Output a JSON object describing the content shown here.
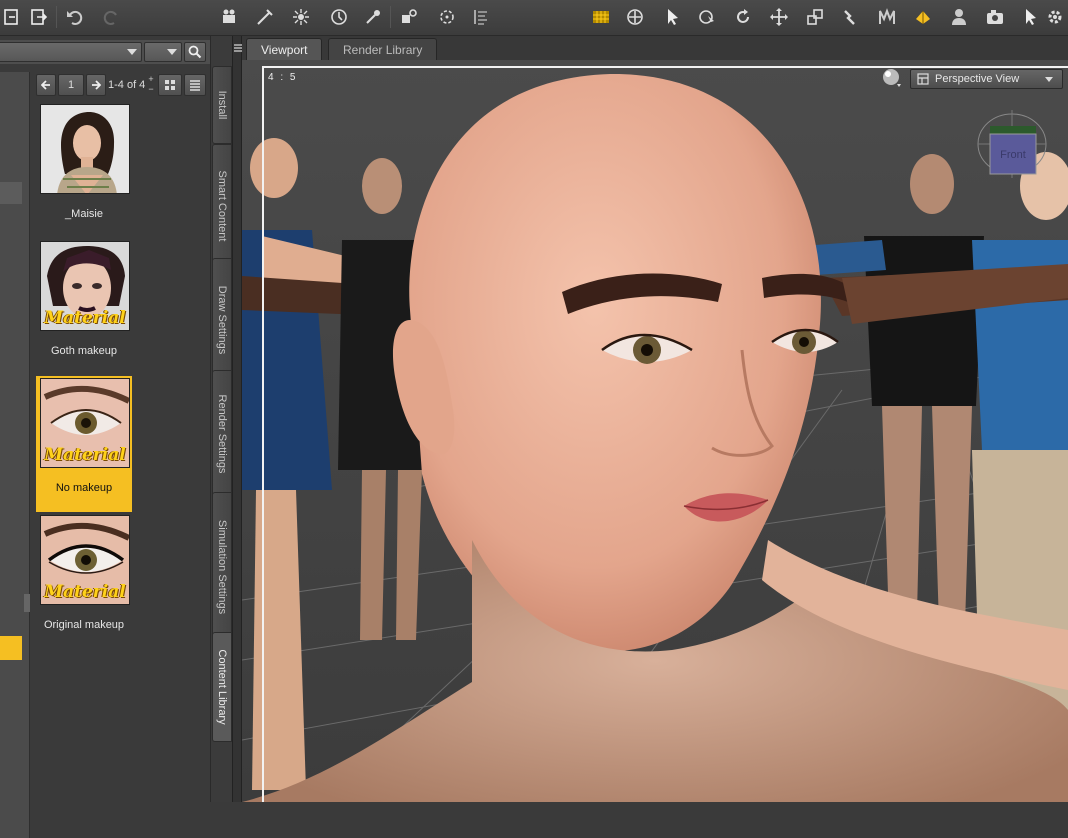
{
  "toolbar": {
    "icons": [
      "new-file-icon",
      "export-icon",
      "undo-icon",
      "redo-icon",
      "figure-camera-icon",
      "spotlight-icon",
      "distant-light-icon",
      "point-light-icon",
      "spot-tool-icon",
      "geometry-add-icon",
      "region-node-icon",
      "text-align-icon",
      "universal-grid-icon",
      "node-select-icon",
      "pointer-icon",
      "rotate-view-icon",
      "rotate-icon",
      "translate-icon",
      "scale-icon",
      "joint-editor-icon",
      "morph-brush-icon",
      "surface-brush-icon",
      "figure-setup-icon",
      "render-camera-icon",
      "render-settings-icon"
    ]
  },
  "content_panel": {
    "page_number": "1",
    "page_count": "1-4 of 4",
    "items": [
      {
        "label": "_Maisie",
        "tag": "",
        "selected": false
      },
      {
        "label": "Goth makeup",
        "tag": "Material",
        "selected": false
      },
      {
        "label": "No makeup",
        "tag": "Material",
        "selected": true
      },
      {
        "label": "Original makeup",
        "tag": "Material",
        "selected": false
      }
    ]
  },
  "pane_tabs": {
    "install": "Install",
    "smart_content": "Smart Content",
    "draw_settings": "Draw Settings",
    "render_settings": "Render Settings",
    "simulation_settings": "Simulation Settings",
    "content_library": "Content Library"
  },
  "viewport_tabs": {
    "viewport": "Viewport",
    "render_library": "Render Library"
  },
  "viewport": {
    "aspect": "4 : 5",
    "view_name": "Perspective View",
    "cube_label": "Front"
  },
  "colors": {
    "accent_selected": "#f5bf22",
    "panel_bg": "#3a3a3a",
    "material_text": "#ffd21a"
  }
}
